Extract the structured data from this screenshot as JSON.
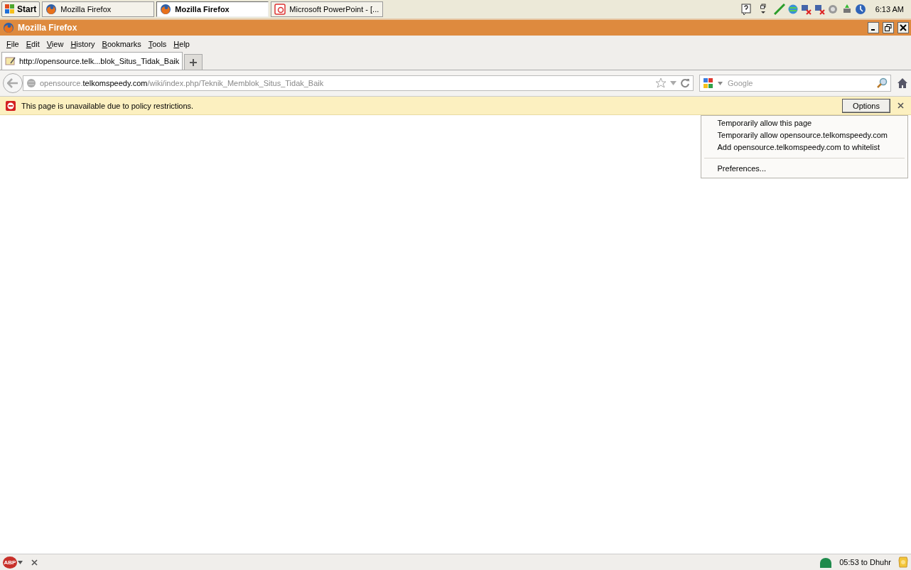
{
  "taskbar": {
    "start": "Start",
    "buttons": [
      {
        "label": "Mozilla Firefox",
        "kind": "firefox",
        "selected": false
      },
      {
        "label": "Mozilla Firefox",
        "kind": "firefox",
        "selected": true
      },
      {
        "label": "Microsoft PowerPoint - [...",
        "kind": "powerpoint",
        "selected": false
      }
    ],
    "clock": "6:13 AM"
  },
  "window": {
    "title": "Mozilla Firefox"
  },
  "menu_bar": [
    {
      "label": "File"
    },
    {
      "label": "Edit"
    },
    {
      "label": "View"
    },
    {
      "label": "History"
    },
    {
      "label": "Bookmarks"
    },
    {
      "label": "Tools"
    },
    {
      "label": "Help"
    }
  ],
  "tabs": [
    {
      "label": "http://opensource.telk...blok_Situs_Tidak_Baik",
      "selected": true
    }
  ],
  "address_bar": {
    "host_prefix": "opensource.",
    "domain": "telkomspeedy.com",
    "path": "/wiki/index.php/Teknik_Memblok_Situs_Tidak_Baik"
  },
  "search": {
    "placeholder": "Google"
  },
  "notification": {
    "message": "This page is unavailable due to policy restrictions.",
    "button": "Options"
  },
  "options_menu": [
    {
      "kind": "item",
      "label": "Temporarily allow this page"
    },
    {
      "kind": "item",
      "label": "Temporarily allow opensource.telkomspeedy.com"
    },
    {
      "kind": "item",
      "label": "Add opensource.telkomspeedy.com to whitelist"
    },
    {
      "kind": "separator"
    },
    {
      "kind": "item",
      "label": "Preferences..."
    }
  ],
  "status_bar": {
    "adblock": "ABP",
    "prayer_time": "05:53 to Dhuhr"
  }
}
